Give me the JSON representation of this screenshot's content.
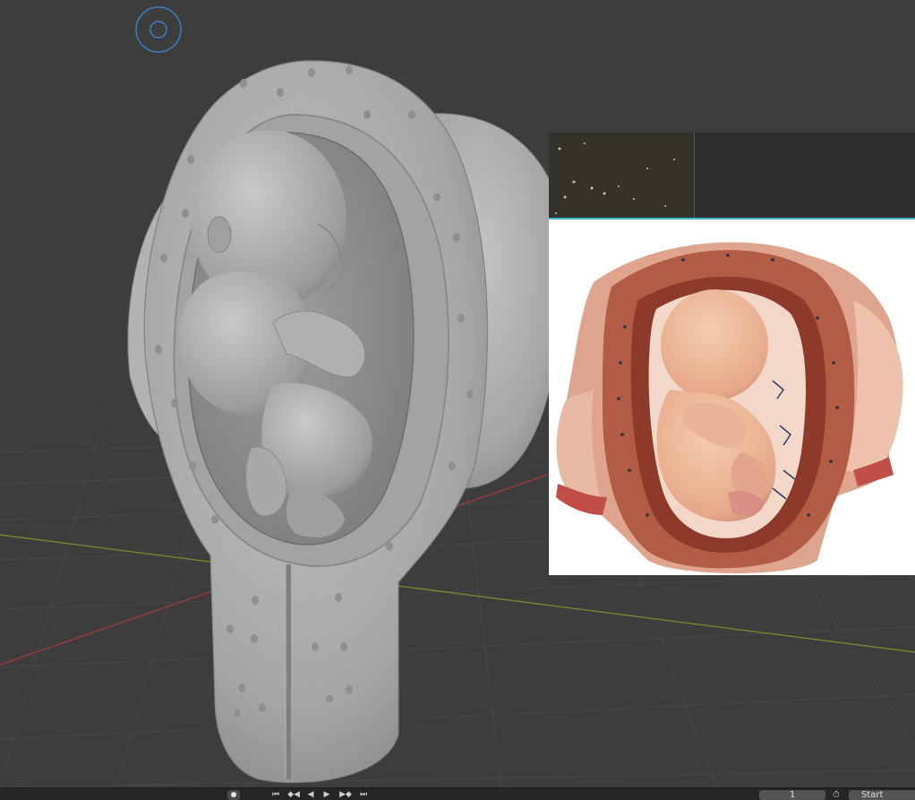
{
  "timeline": {
    "controls": [
      {
        "name": "jump-start-icon",
        "glyph": "⏮"
      },
      {
        "name": "keyframe-prev-icon",
        "glyph": "◆◀"
      },
      {
        "name": "play-reverse-icon",
        "glyph": "◀"
      },
      {
        "name": "play-icon",
        "glyph": "▶"
      },
      {
        "name": "keyframe-next-icon",
        "glyph": "▶◆"
      },
      {
        "name": "jump-end-icon",
        "glyph": "⏭"
      }
    ],
    "current_frame": "1",
    "start_label": "Start"
  },
  "colors": {
    "viewport_bg": "#3d3d3d",
    "grid": "#4a4a4a",
    "axis_x": "#9b3b3b",
    "axis_y": "#6e8a2f",
    "model": "#a9a9a9",
    "gizmo": "#3a7fc4",
    "accent_cyan": "#3fb6c9"
  },
  "icons": [
    "viewport-gizmo-icon",
    "record-icon",
    "stopwatch-icon"
  ]
}
